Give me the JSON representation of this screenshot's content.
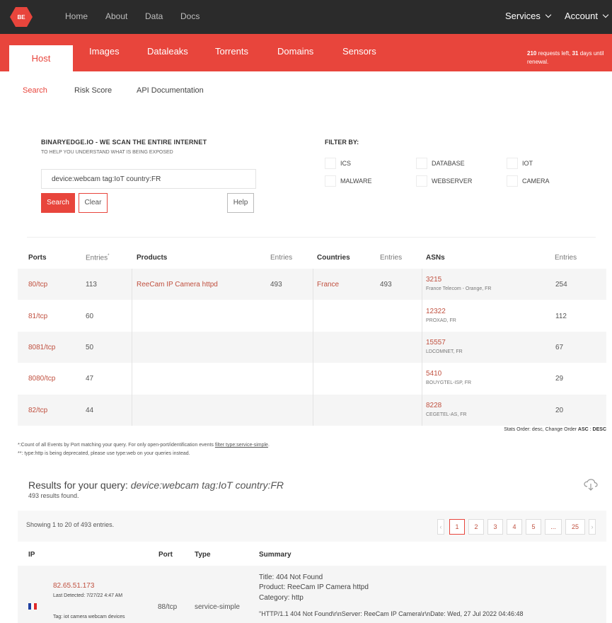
{
  "brand": {
    "logo_text": "BE",
    "accent": "#e8453c"
  },
  "topnav": {
    "links": [
      "Home",
      "About",
      "Data",
      "Docs"
    ],
    "services": "Services",
    "account": "Account"
  },
  "tabs": [
    "Host",
    "Images",
    "Dataleaks",
    "Torrents",
    "Domains",
    "Sensors"
  ],
  "quota": {
    "requests": "210",
    "mid": " requests left, ",
    "days": "31",
    "end": " days until renewal."
  },
  "subnav": [
    "Search",
    "Risk Score",
    "API Documentation"
  ],
  "search": {
    "title": "BINARYEDGE.IO - WE SCAN THE ENTIRE INTERNET",
    "subtitle": "TO HELP YOU UNDERSTAND WHAT IS BEING EXPOSED",
    "query": "device:webcam tag:IoT country:FR",
    "search_label": "Search",
    "clear_label": "Clear",
    "help_label": "Help"
  },
  "filters": {
    "title": "FILTER BY:",
    "items": [
      "ICS",
      "DATABASE",
      "IOT",
      "MALWARE",
      "WEBSERVER",
      "CAMERA"
    ]
  },
  "aggregation": {
    "headers": {
      "ports": "Ports",
      "entries": "Entries",
      "entries_mark": "*",
      "products": "Products",
      "countries": "Countries",
      "asns": "ASNs"
    },
    "rows": [
      {
        "port": "80/tcp",
        "port_entries": "113",
        "product": "ReeCam IP Camera httpd",
        "product_entries": "493",
        "country": "France",
        "country_entries": "493",
        "asn": "3215",
        "asn_name": "France Telecom - Orange, FR",
        "asn_entries": "254"
      },
      {
        "port": "81/tcp",
        "port_entries": "60",
        "asn": "12322",
        "asn_name": "PROXAD, FR",
        "asn_entries": "112"
      },
      {
        "port": "8081/tcp",
        "port_entries": "50",
        "asn": "15557",
        "asn_name": "LDCOMNET, FR",
        "asn_entries": "67"
      },
      {
        "port": "8080/tcp",
        "port_entries": "47",
        "asn": "5410",
        "asn_name": "BOUYGTEL-ISP, FR",
        "asn_entries": "29"
      },
      {
        "port": "82/tcp",
        "port_entries": "44",
        "asn": "8228",
        "asn_name": "CEGETEL-AS, FR",
        "asn_entries": "20"
      }
    ],
    "stats_order_prefix": "Stats Order: desc, Change Order ",
    "stats_order_asc": "ASC",
    "stats_order_sep": " : ",
    "stats_order_desc": "DESC"
  },
  "notes": {
    "note1_prefix": "*:Count of all Events by Port matching your query. For only open-port/identification events ",
    "note1_link": "filter type:service-simple",
    "note1_suffix": ".",
    "note2": "**: type:http is being deprecated, please use type:web on your queries instead."
  },
  "results": {
    "title_prefix": "Results for your query: ",
    "title_query": "device:webcam tag:IoT country:FR",
    "count": "493 results found.",
    "showing": "Showing 1 to 20 of 493 entries.",
    "pages": [
      "1",
      "2",
      "3",
      "4",
      "5",
      "...",
      "25"
    ],
    "prev": "‹",
    "next": "›",
    "headers": {
      "ip": "IP",
      "port": "Port",
      "type": "Type",
      "summary": "Summary"
    },
    "row": {
      "ip": "82.65.51.173",
      "detected": "Last Detected: 7/27/22 4:47 AM",
      "tags": "Tag: iot camera webcam devices",
      "flag": "fr-flag",
      "port": "88/tcp",
      "type": "service-simple",
      "summary_title": "Title: 404 Not Found",
      "summary_product": "Product: ReeCam IP Camera httpd",
      "summary_category": "Category: http",
      "summary_raw": "\"HTTP/1.1 404 Not Found\\r\\nServer: ReeCam IP Camera\\r\\nDate: Wed, 27 Jul 2022 04:46:48"
    }
  }
}
